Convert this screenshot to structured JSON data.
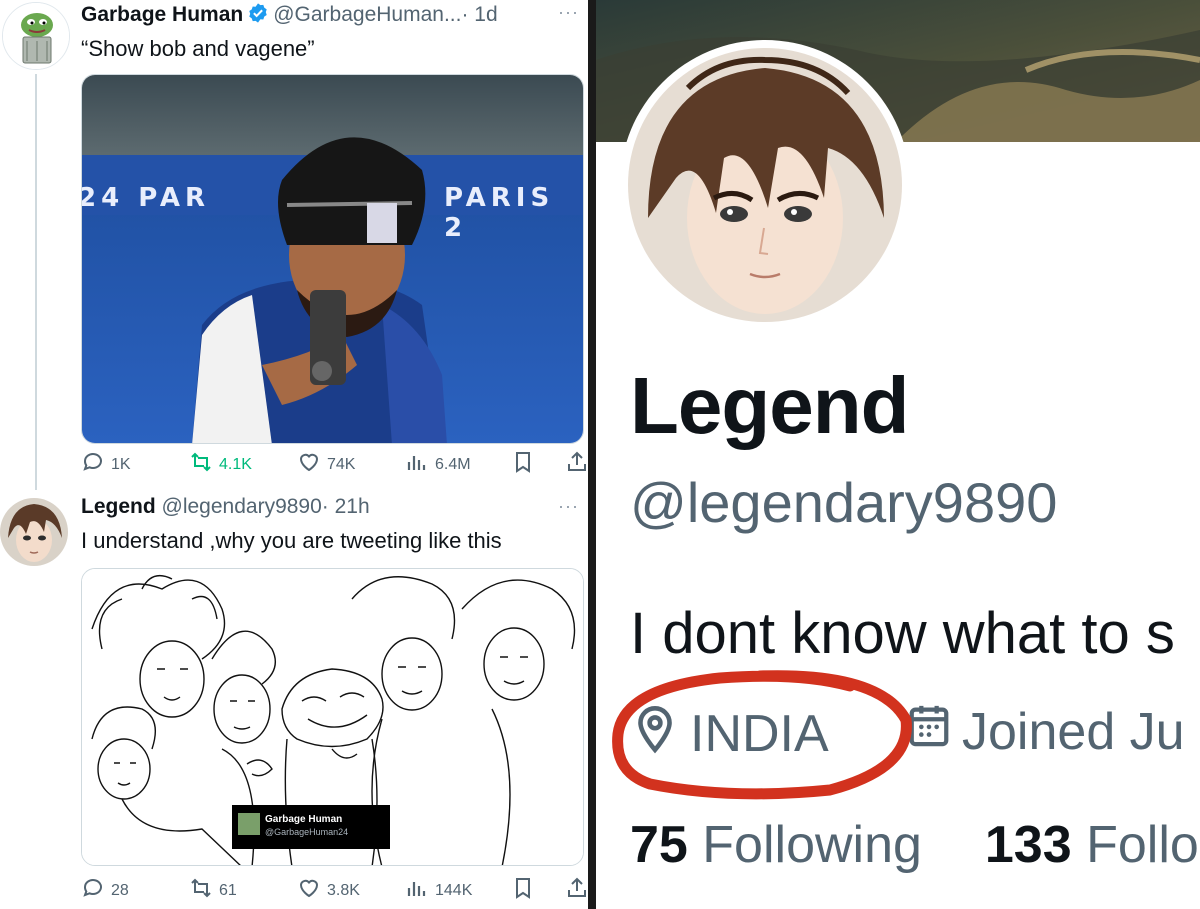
{
  "left_panel": {
    "tweet1": {
      "display_name": "Garbage Human",
      "handle": "@GarbageHuman...",
      "time": "· 1d",
      "text": "“Show bob and vagene”",
      "media_text": {
        "banner_left": "24 PAR",
        "banner_right": "PARIS 2"
      },
      "actions": {
        "replies": "1K",
        "reposts": "4.1K",
        "likes": "74K",
        "views": "6.4M"
      }
    },
    "tweet2": {
      "display_name": "Legend",
      "handle": "@legendary9890",
      "time": "· 21h",
      "text": "I understand ,why you are tweeting like this",
      "media_caption": {
        "name": "Garbage Human",
        "handle": "@GarbageHuman24"
      },
      "actions": {
        "replies": "28",
        "reposts": "61",
        "likes": "3.8K",
        "views": "144K"
      }
    },
    "avatar1_text": "GARBAGE HUMAN"
  },
  "right_panel": {
    "display_name": "Legend",
    "handle": "@legendary9890",
    "bio": "I dont know what to s",
    "location": "INDIA",
    "joined": "Joined Ju",
    "following_count": "75",
    "following_label": "Following",
    "followers_count": "133",
    "followers_label": "Follo"
  },
  "colors": {
    "text_primary": "#0f1419",
    "text_secondary": "#536471",
    "verified_blue": "#1d9bf0",
    "repost_green": "#00ba7c",
    "annotation_red": "#d2321e"
  },
  "icons": [
    "more-icon",
    "reply-icon",
    "repost-icon",
    "like-icon",
    "views-icon",
    "bookmark-icon",
    "share-icon",
    "verified-icon",
    "location-icon",
    "calendar-icon"
  ]
}
